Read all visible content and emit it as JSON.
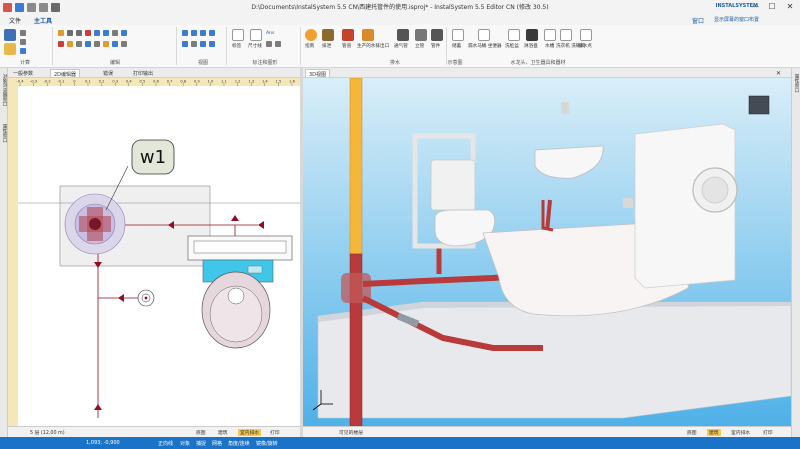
{
  "window": {
    "title": "D:\\Documents\\InstalSystem 5.5 CN\\西建托管件的使用.isproj* - InstalSystem 5.5 Editor CN (修改 30.5)",
    "min": "—",
    "max": "☐",
    "close": "✕"
  },
  "menu": {
    "file": "文件",
    "home": "主工具"
  },
  "ribbon": {
    "groups": [
      "计算",
      "编辑",
      "视图",
      "标注和图形",
      "排水",
      "示意图",
      "水龙头、卫生器具和器材"
    ],
    "labels": [
      "标签",
      "尺寸线",
      "Ans",
      "指南",
      "排泄",
      "管道",
      "生产的水排出口",
      "通气管",
      "立管",
      "管件",
      "储蓄",
      "漏水马桶 坐便器",
      "洗脸盆",
      "淋浴盘",
      "水槽",
      "洗衣机 洗碗机",
      "排水点"
    ],
    "right_actions": [
      "窗口",
      "显示屏幕的窗口布置"
    ],
    "brand": "INSTALSYSTEM"
  },
  "left_panel_tabs": [
    "对象浏览器窗口",
    "属性窗口"
  ],
  "right_panel_tabs": [
    "属性窗口"
  ],
  "plan_tabs": [
    "一般参数",
    "2D编辑器",
    "错误",
    "打印输出"
  ],
  "view3d_tab": "3D视图",
  "plan": {
    "label_tag": "w1",
    "ruler_ticks": [
      "-0.4",
      "-0.3",
      "-0.2",
      "-0.1",
      "0",
      "0.1",
      "0.2",
      "0.3",
      "0.4",
      "0.5",
      "0.6",
      "0.7",
      "0.8",
      "0.9",
      "1.0",
      "1.1",
      "1.2",
      "1.3",
      "1.4",
      "1.5",
      "1.6"
    ]
  },
  "plan_bottom": {
    "level": "5 层 (12,00 m)",
    "tabs": [
      "底图",
      "建筑",
      "室内排水",
      "打印"
    ],
    "active_tab": "室内排水"
  },
  "view3d_bottom": {
    "layer": "可见的楼层",
    "tabs": [
      "底图",
      "建筑",
      "室内排水",
      "打印"
    ],
    "active_tab": "建筑"
  },
  "statusbar": {
    "coords": "1,093; -0,900",
    "modes": [
      "正向线",
      "对象",
      "捕捉",
      "网格",
      "角度/连续",
      "镜像/旋转"
    ]
  },
  "colors": {
    "accent": "#1a73c7",
    "pipe_red": "#b83a3a",
    "pipe_yellow": "#f4b73c",
    "plan_marker": "#8b1020"
  }
}
